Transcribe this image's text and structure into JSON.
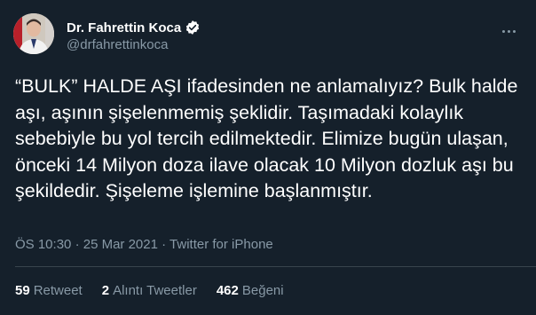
{
  "author": {
    "display_name": "Dr. Fahrettin Koca",
    "handle": "@drfahrettinkoca",
    "verified_icon": "verified-badge-icon"
  },
  "tweet": {
    "text": "“BULK” HALDE AŞI ifadesinden ne anlamalıyız? Bulk halde aşı, aşının şişelenmemiş şeklidir. Taşımadaki kolaylık sebebiyle bu yol tercih edilmektedir. Elimize bugün ulaşan, önceki 14 Milyon doza ilave olacak 10 Milyon dozluk aşı bu şekildedir. Şişeleme işlemine başlanmıştır.",
    "time": "ÖS 10:30",
    "separator": "·",
    "date": "25 Mar 2021",
    "client": "Twitter for iPhone"
  },
  "stats": {
    "retweets_count": "59",
    "retweets_label": "Retweet",
    "quotes_count": "2",
    "quotes_label": "Alıntı Tweetler",
    "likes_count": "462",
    "likes_label": "Beğeni"
  },
  "colors": {
    "background": "#15202b",
    "text": "#ffffff",
    "secondary": "#8899a6",
    "verified": "#1da1f2"
  }
}
